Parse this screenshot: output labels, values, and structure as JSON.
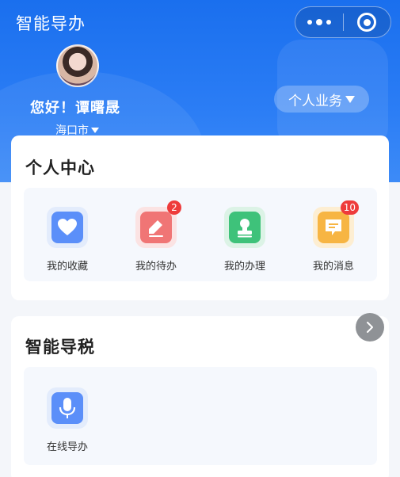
{
  "header": {
    "app_title": "智能导办",
    "greeting": "您好！谭曙晟",
    "city": "海口市",
    "business_button": "个人业务"
  },
  "personal_center": {
    "title": "个人中心",
    "items": [
      {
        "label": "我的收藏",
        "icon": "heart-icon",
        "color": "#5b8ff9",
        "badge": ""
      },
      {
        "label": "我的待办",
        "icon": "edit-icon",
        "color": "#f07575",
        "badge": "2"
      },
      {
        "label": "我的办理",
        "icon": "stamp-icon",
        "color": "#3ec27a",
        "badge": ""
      },
      {
        "label": "我的消息",
        "icon": "message-icon",
        "color": "#f7b543",
        "badge": "10"
      }
    ]
  },
  "smart_tax": {
    "title": "智能导税",
    "items": [
      {
        "label": "在线导办",
        "icon": "microphone-icon",
        "color": "#5b8ff9"
      }
    ]
  },
  "colors": {
    "header_blue": "#1a6fee",
    "badge_red": "#ee3b3b"
  }
}
